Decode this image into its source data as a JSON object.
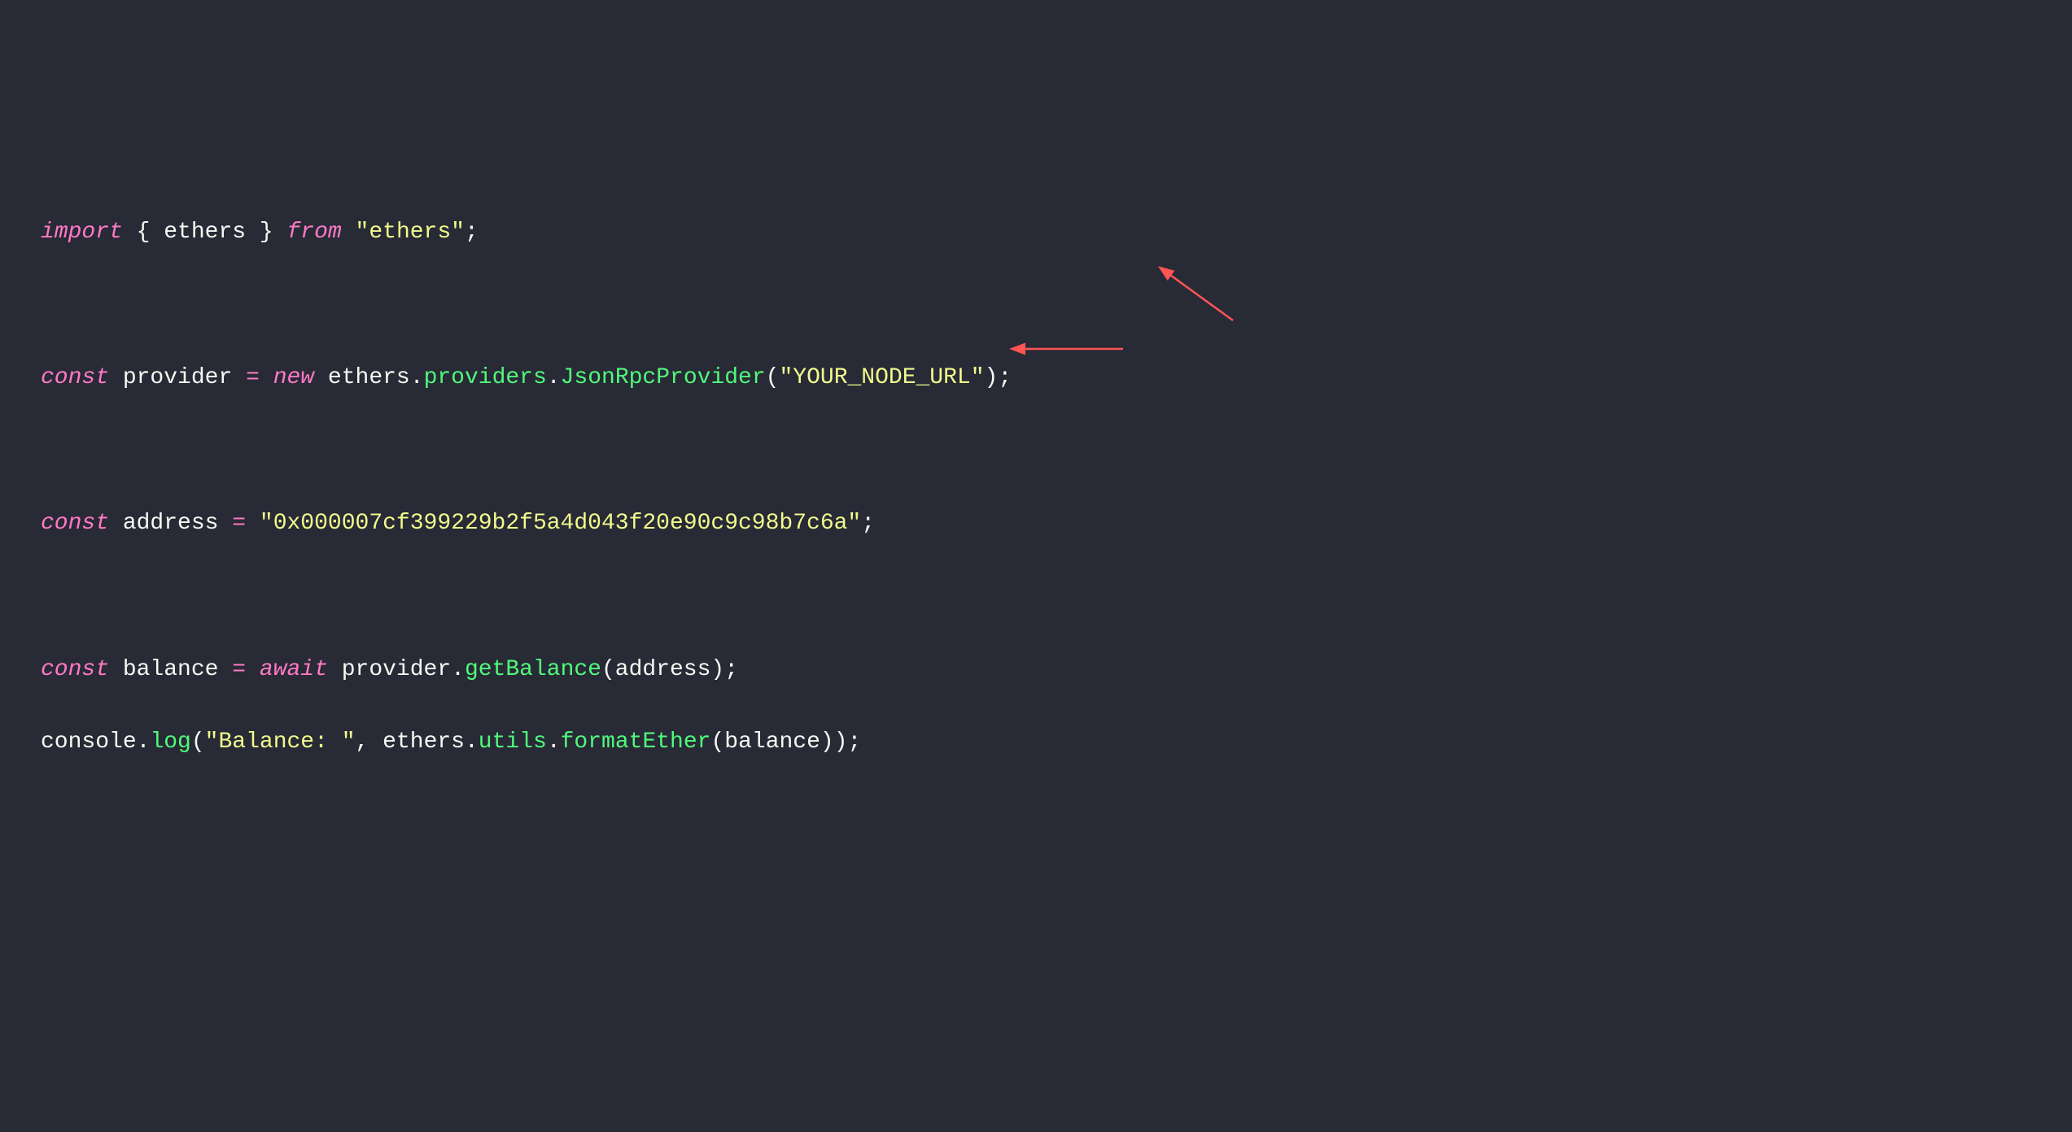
{
  "code": {
    "line1": {
      "import": "import",
      "open_brace": " { ",
      "ethers": "ethers",
      "close_brace": " } ",
      "from": "from",
      "space": " ",
      "q1": "\"",
      "module": "ethers",
      "q2": "\"",
      "semi": ";"
    },
    "line3": {
      "const": "const",
      "space1": " ",
      "provider": "provider",
      "space2": " ",
      "eq": "=",
      "space3": " ",
      "new": "new",
      "space4": " ",
      "ethers": "ethers",
      "dot1": ".",
      "providers": "providers",
      "dot2": ".",
      "jsonrpc": "JsonRpcProvider",
      "open": "(",
      "q1": "\"",
      "url": "YOUR_NODE_URL",
      "q2": "\"",
      "close": ")",
      "semi": ";"
    },
    "line5": {
      "const": "const",
      "space1": " ",
      "address": "address",
      "space2": " ",
      "eq": "=",
      "space3": " ",
      "q1": "\"",
      "addr_val": "0x000007cf399229b2f5a4d043f20e90c9c98b7c6a",
      "q2": "\"",
      "semi": ";"
    },
    "line7": {
      "const": "const",
      "space1": " ",
      "balance": "balance",
      "space2": " ",
      "eq": "=",
      "space3": " ",
      "await": "await",
      "space4": " ",
      "provider": "provider",
      "dot1": ".",
      "getBalance": "getBalance",
      "open": "(",
      "address": "address",
      "close": ")",
      "semi": ";"
    },
    "line8": {
      "console": "console",
      "dot1": ".",
      "log": "log",
      "open": "(",
      "q1": "\"",
      "label": "Balance: ",
      "q2": "\"",
      "comma": ",",
      "space": " ",
      "ethers": "ethers",
      "dot2": ".",
      "utils": "utils",
      "dot3": ".",
      "formatEther": "formatEther",
      "open2": "(",
      "balance": "balance",
      "close2": ")",
      "close": ")",
      "semi": ";"
    }
  }
}
